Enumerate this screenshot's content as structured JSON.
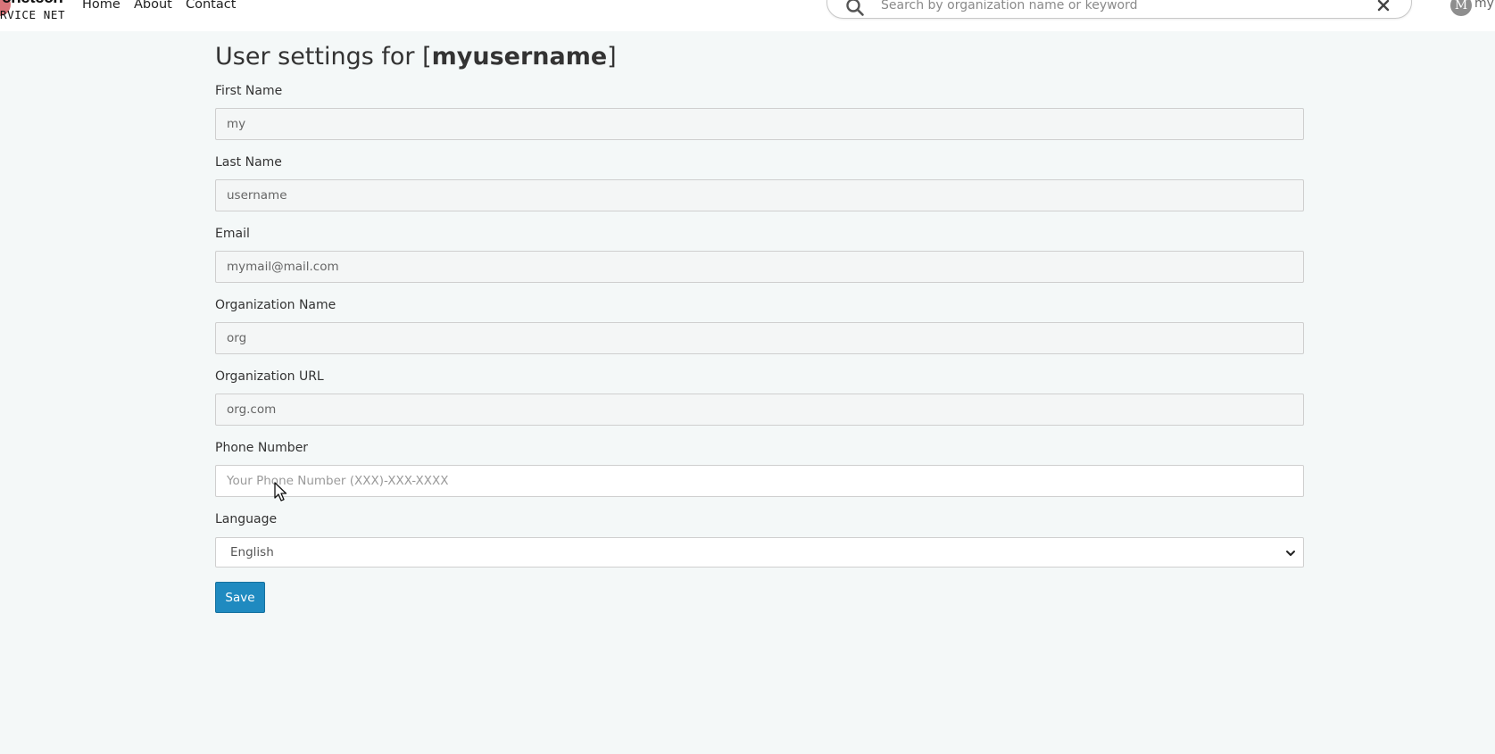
{
  "navbar": {
    "logo": {
      "line1": "cnetech",
      "line2": "RVICE NET"
    },
    "links": [
      "Home",
      "About",
      "Contact"
    ],
    "search": {
      "placeholder": "Search by organization name or keyword",
      "value": ""
    },
    "user": {
      "avatar_letter": "M",
      "label": "my"
    }
  },
  "page": {
    "title_prefix": "User settings for [",
    "title_username": "myusername",
    "title_suffix": "]"
  },
  "form": {
    "first_name": {
      "label": "First Name",
      "value": "my"
    },
    "last_name": {
      "label": "Last Name",
      "value": "username"
    },
    "email": {
      "label": "Email",
      "value": "mymail@mail.com"
    },
    "org_name": {
      "label": "Organization Name",
      "value": "org"
    },
    "org_url": {
      "label": "Organization URL",
      "value": "org.com"
    },
    "phone": {
      "label": "Phone Number",
      "value": "",
      "placeholder": "Your Phone Number (XXX)-XXX-XXXX"
    },
    "language": {
      "label": "Language",
      "selected": "English"
    },
    "save_label": "Save"
  },
  "colors": {
    "page_background": "#f4f8f8",
    "navbar_background": "#ffffff",
    "button_primary": "#1f8ac0",
    "logo_accent": "#d9757a",
    "avatar": "#8e8e8e"
  },
  "icons": {
    "search": "search-icon",
    "clear": "close-icon",
    "dropdown": "chevron-down-icon",
    "pointer": "mouse-cursor-icon"
  }
}
